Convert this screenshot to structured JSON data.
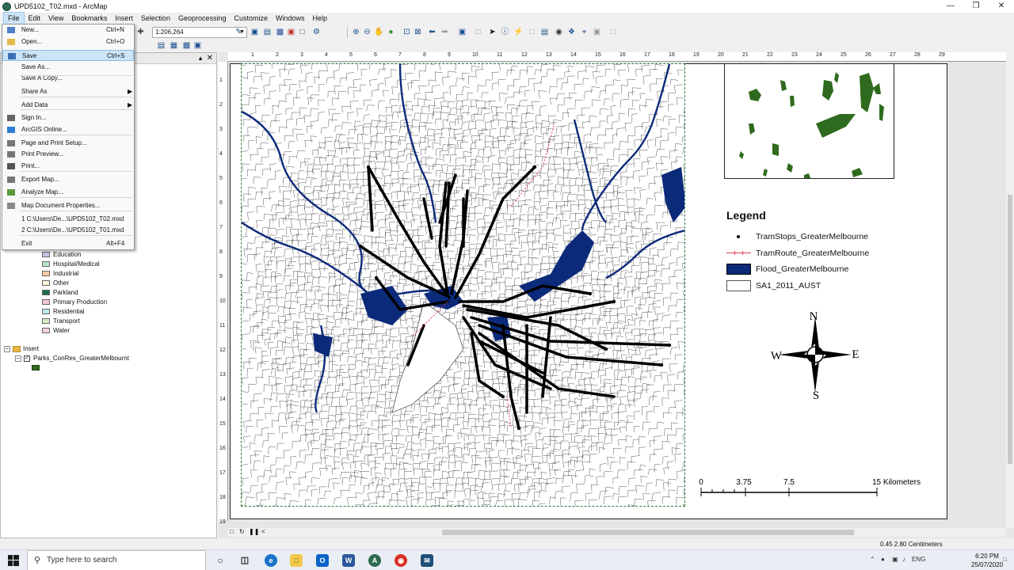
{
  "window": {
    "title": "UPD5102_T02.mxd - ArcMap"
  },
  "menubar": [
    "File",
    "Edit",
    "View",
    "Bookmarks",
    "Insert",
    "Selection",
    "Geoprocessing",
    "Customize",
    "Windows",
    "Help"
  ],
  "toolbar": {
    "scale": "1:206,264"
  },
  "file_menu": {
    "items": [
      {
        "label": "New...",
        "shortcut": "Ctrl+N"
      },
      {
        "label": "Open...",
        "shortcut": "Ctrl+O"
      },
      {
        "label": "Save",
        "shortcut": "Ctrl+S"
      },
      {
        "label": "Save As...",
        "shortcut": ""
      },
      {
        "label": "Save A Copy...",
        "shortcut": ""
      },
      {
        "label": "Share As",
        "shortcut": ""
      },
      {
        "label": "Add Data",
        "shortcut": ""
      },
      {
        "label": "Sign In...",
        "shortcut": ""
      },
      {
        "label": "ArcGIS Online...",
        "shortcut": ""
      },
      {
        "label": "Page and Print Setup...",
        "shortcut": ""
      },
      {
        "label": "Print Preview...",
        "shortcut": ""
      },
      {
        "label": "Print...",
        "shortcut": ""
      },
      {
        "label": "Export Map...",
        "shortcut": ""
      },
      {
        "label": "Analyze Map...",
        "shortcut": ""
      },
      {
        "label": "Map Document Properties...",
        "shortcut": ""
      },
      {
        "label": "1 C:\\Users\\De...\\UPD5102_T02.mxd",
        "shortcut": ""
      },
      {
        "label": "2 C:\\Users\\De...\\UPD5102_T01.mxd",
        "shortcut": ""
      },
      {
        "label": "Exit",
        "shortcut": "Alt+F4"
      }
    ]
  },
  "toc": {
    "landuse_classes": [
      {
        "label": "Education",
        "color": "#c7c2e8"
      },
      {
        "label": "Hospital/Medical",
        "color": "#b6e6c9"
      },
      {
        "label": "Industrial",
        "color": "#f3c9a8"
      },
      {
        "label": "Other",
        "color": "#fbf4d6"
      },
      {
        "label": "Parkland",
        "color": "#1f6b45"
      },
      {
        "label": "Primary Production",
        "color": "#f4c6dc"
      },
      {
        "label": "Residential",
        "color": "#b8e7ea"
      },
      {
        "label": "Transport",
        "color": "#d9ecc5"
      },
      {
        "label": "Water",
        "color": "#f5d2d8"
      }
    ],
    "frame_name": "Insert",
    "layer_name": "Parks_ConRes_GreaterMelbournt",
    "layer_color": "#2f6b1e"
  },
  "rulers": {
    "top": [
      "1",
      "2",
      "3",
      "4",
      "5",
      "6",
      "7",
      "8",
      "9",
      "10",
      "11",
      "12",
      "13",
      "14",
      "15",
      "16",
      "17",
      "18",
      "19",
      "20",
      "21",
      "22",
      "23",
      "24",
      "25",
      "26",
      "27",
      "28",
      "29"
    ],
    "left": [
      "1",
      "2",
      "3",
      "4",
      "5",
      "6",
      "7",
      "8",
      "9",
      "10",
      "11",
      "12",
      "13",
      "14",
      "15",
      "16",
      "17",
      "18",
      "19"
    ]
  },
  "legend": {
    "title": "Legend",
    "items": [
      {
        "label": "TramStops_GreaterMelbourne",
        "symbol": "point"
      },
      {
        "label": "TramRoute_GreaterMelbourne",
        "symbol": "line"
      },
      {
        "label": "Flood_GreaterMelbourne",
        "symbol": "fill-navy"
      },
      {
        "label": "SA1_2011_AUST",
        "symbol": "fill-white"
      }
    ]
  },
  "north_arrow": {
    "n": "N",
    "s": "S",
    "e": "E",
    "w": "W"
  },
  "scalebar": {
    "labels": [
      "0",
      "3.75",
      "7.5",
      "15 Kilometers"
    ]
  },
  "status": {
    "coords": "0.45  2.80 Centimeters"
  },
  "taskbar": {
    "search_placeholder": "Type here to search",
    "language": "ENG",
    "time": "6:20 PM",
    "date": "25/07/2020"
  },
  "colors": {
    "flood": "#0b2a7a",
    "tram_route": "#e0405a",
    "parkland": "#2f6b1e",
    "accent": "#0078d7"
  }
}
